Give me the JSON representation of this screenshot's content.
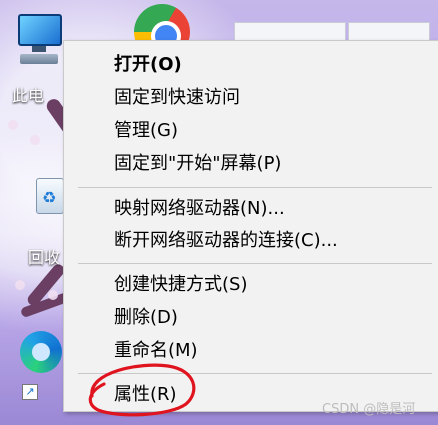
{
  "desktop": {
    "icons": [
      {
        "label": "此电"
      },
      {
        "label": "回收"
      },
      {
        "label": ""
      }
    ]
  },
  "context_menu": {
    "items": [
      {
        "label": "打开(O)",
        "bold": true
      },
      {
        "label": "固定到快速访问"
      },
      {
        "label": "管理(G)"
      },
      {
        "label": "固定到\"开始\"屏幕(P)"
      },
      {
        "label": "映射网络驱动器(N)..."
      },
      {
        "label": "断开网络驱动器的连接(C)..."
      },
      {
        "label": "创建快捷方式(S)"
      },
      {
        "label": "删除(D)"
      },
      {
        "label": "重命名(M)"
      },
      {
        "label": "属性(R)"
      }
    ]
  },
  "watermark": "CSDN @隐是河",
  "colors": {
    "menu_bg": "#f2f2f2",
    "annotation": "#e0141e"
  }
}
